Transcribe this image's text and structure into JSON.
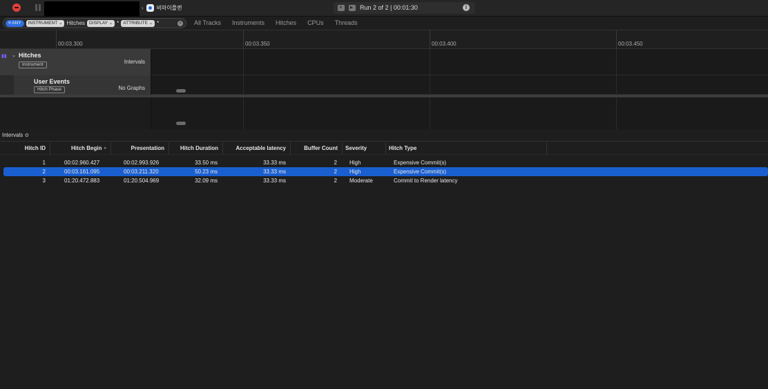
{
  "toolbar": {
    "target_name": "비마이플랜",
    "run_label": "Run 2 of 2",
    "run_time": "00:01:30",
    "info_glyph": "i"
  },
  "filter": {
    "any_chip": "≡ ANY",
    "instrument_chip": "INSTRUMENT ⌄",
    "instrument_value": "Hitches",
    "display_chip": "DISPLAY ⌄",
    "display_value": "*",
    "attribute_chip": "ATTRIBUTE ⌄",
    "attribute_value": "*",
    "clear_glyph": "×"
  },
  "scope_tabs": [
    "All Tracks",
    "Instruments",
    "Hitches",
    "CPUs",
    "Threads"
  ],
  "ruler": {
    "ticks": [
      "00:03.300",
      "00:03.350",
      "00:03.400",
      "00:03.450"
    ]
  },
  "tracks": {
    "hitches": {
      "title": "Hitches",
      "tag": "Instrument",
      "mode": "Intervals"
    },
    "user_events": {
      "title": "User Events",
      "tag": "Hitch Phase",
      "mode": "No Graphs"
    }
  },
  "detail": {
    "label": "Intervals ≎"
  },
  "table": {
    "columns": [
      "Hitch ID",
      "Hitch Begin",
      "Presentation",
      "Hitch Duration",
      "Acceptable latency",
      "Buffer Count",
      "Severity",
      "Hitch Type"
    ],
    "sort_glyph": "^",
    "rows": [
      [
        "1",
        "00:02.960.427",
        "00:02.993.926",
        "33.50 ms",
        "33.33 ms",
        "2",
        "High",
        "Expensive Commit(s)"
      ],
      [
        "2",
        "00:03.161.095",
        "00:03.211.320",
        "50.23 ms",
        "33.33 ms",
        "2",
        "High",
        "Expensive Commit(s)"
      ],
      [
        "3",
        "01:20.472.883",
        "01:20.504.969",
        "32.09 ms",
        "33.33 ms",
        "2",
        "Moderate",
        "Commit to Render latency"
      ]
    ],
    "selected_row": 1
  }
}
